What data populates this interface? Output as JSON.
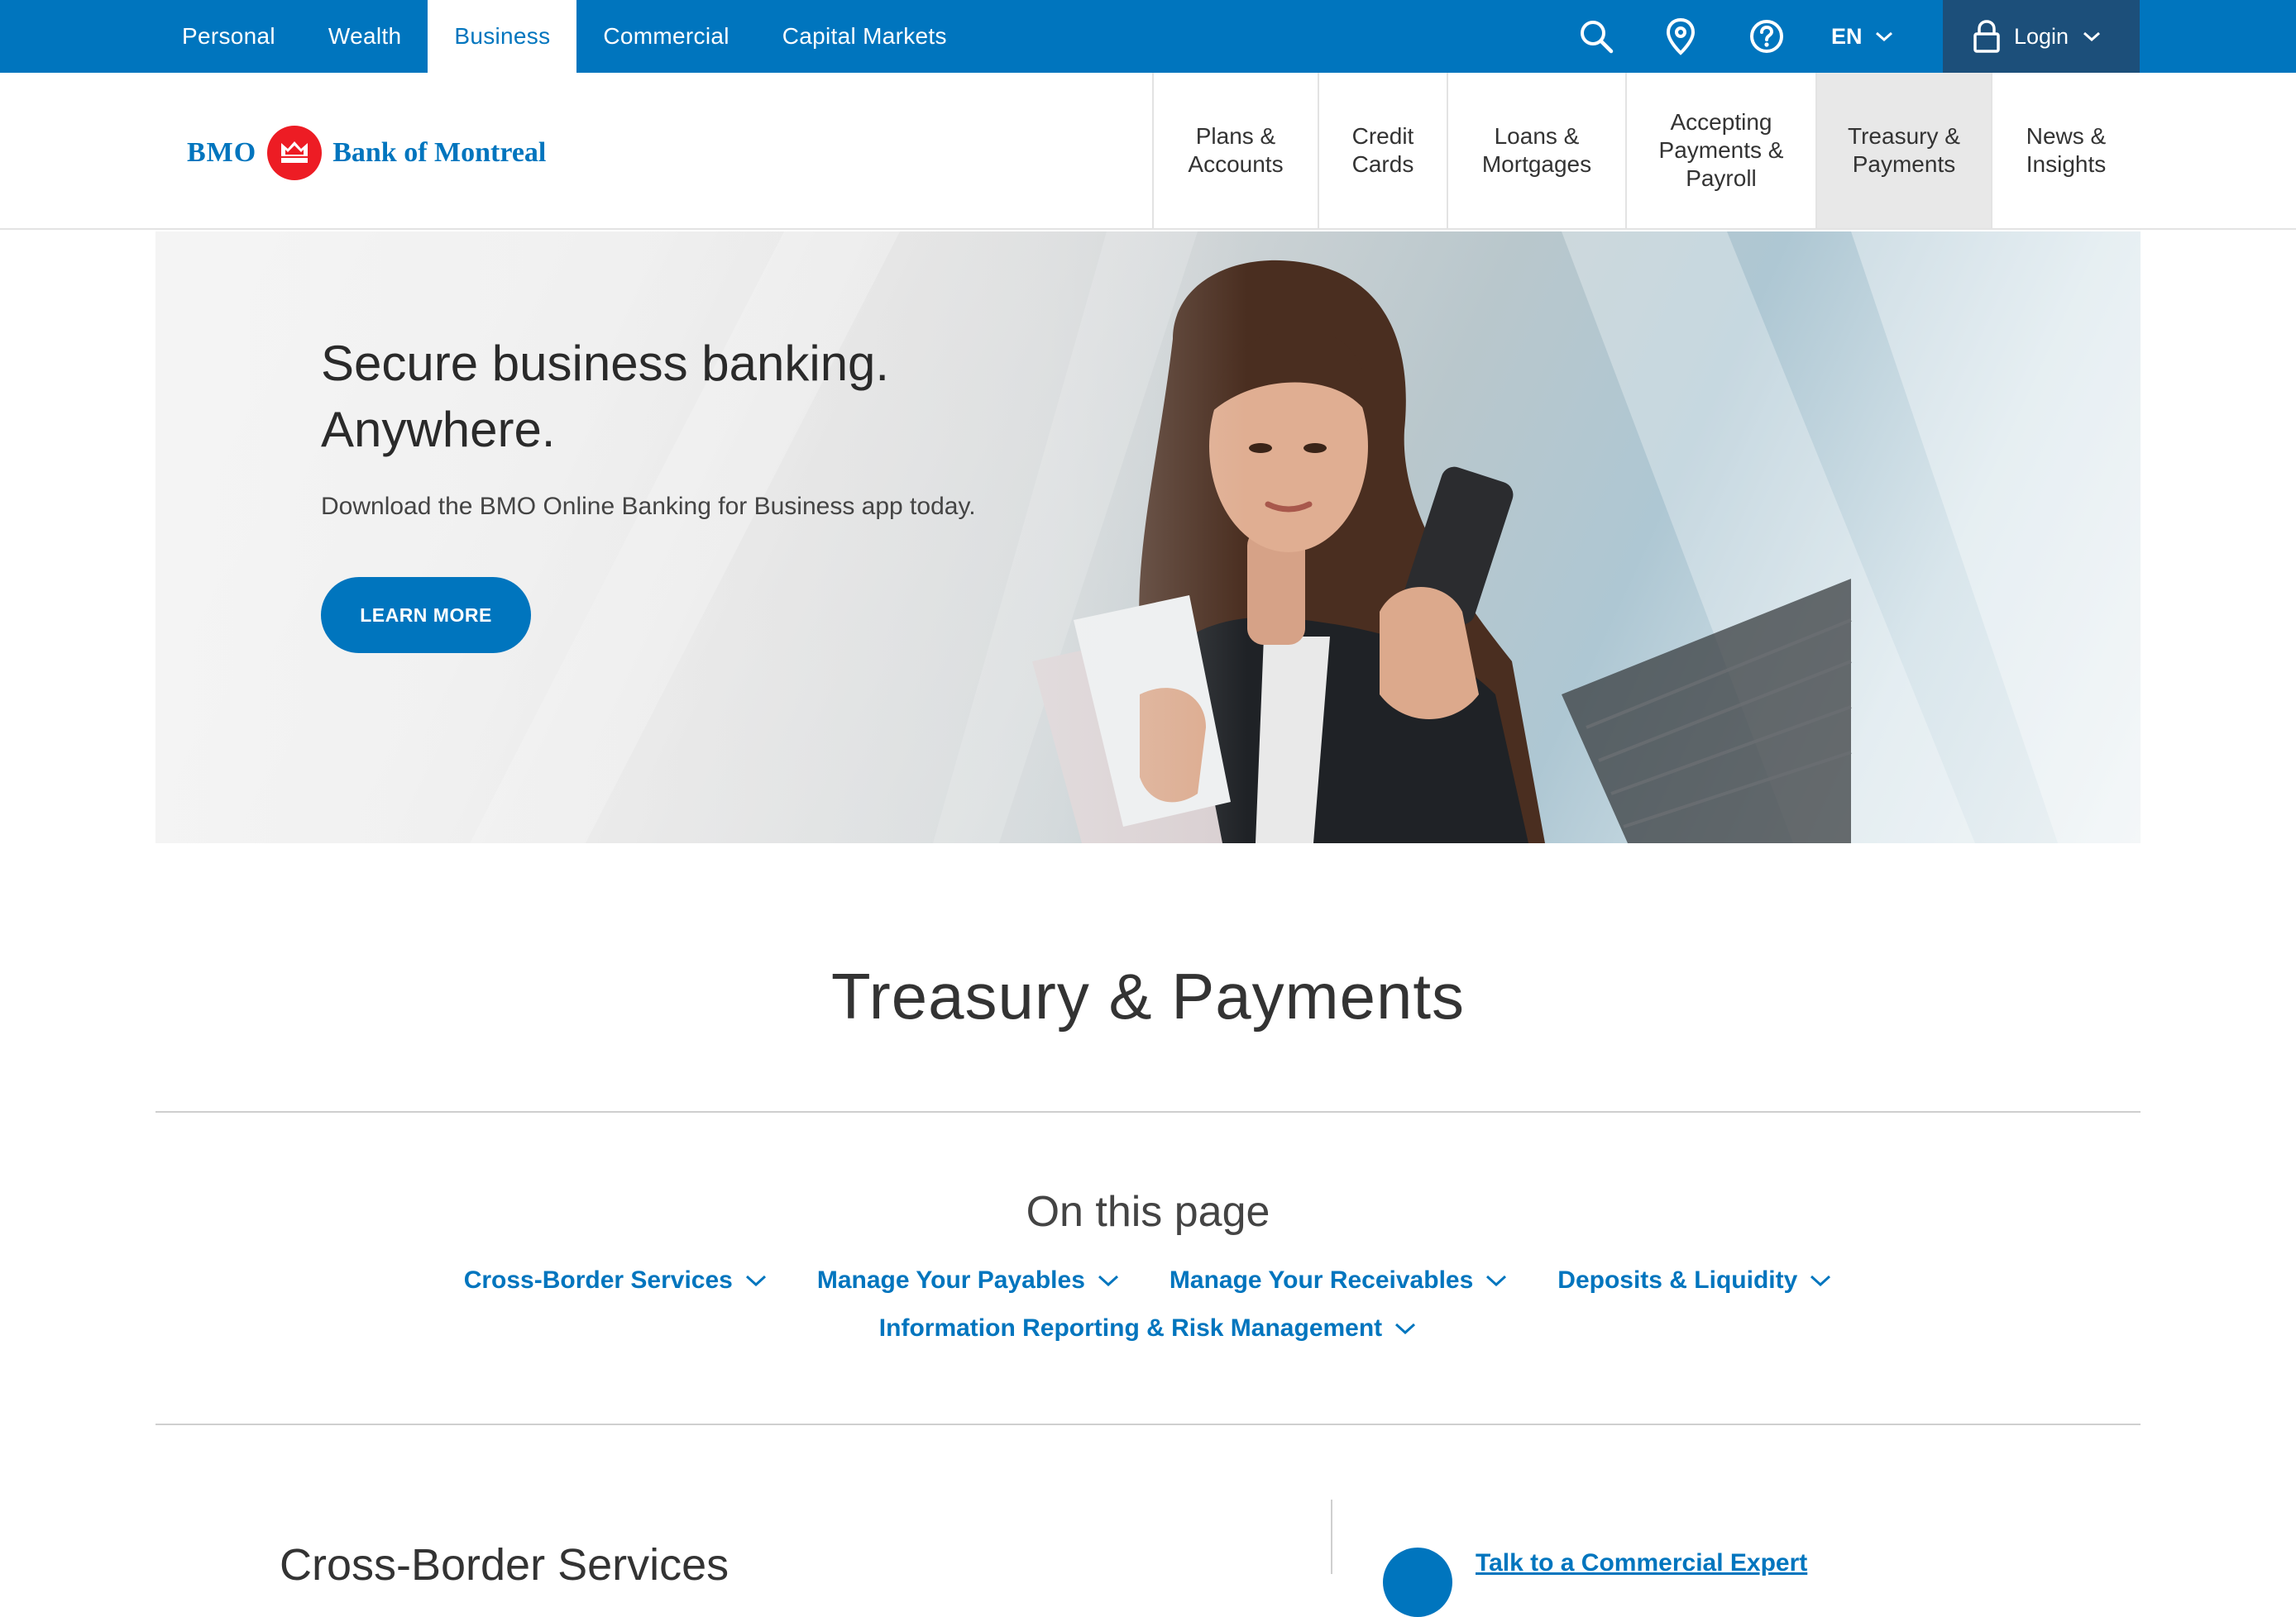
{
  "colors": {
    "brand_blue": "#0075be",
    "login_navy": "#1c4f7a",
    "logo_red": "#ed1c24"
  },
  "topbar": {
    "segments": [
      {
        "label": "Personal",
        "active": false
      },
      {
        "label": "Wealth",
        "active": false
      },
      {
        "label": "Business",
        "active": true
      },
      {
        "label": "Commercial",
        "active": false
      },
      {
        "label": "Capital Markets",
        "active": false
      }
    ],
    "icons": [
      "search-icon",
      "location-pin-icon",
      "help-icon"
    ],
    "language": "EN",
    "login_label": "Login"
  },
  "logo": {
    "bmo": "BMO",
    "name": "Bank of Montreal"
  },
  "mainnav": {
    "items": [
      {
        "label": "Plans &\nAccounts",
        "active": false
      },
      {
        "label": "Credit\nCards",
        "active": false
      },
      {
        "label": "Loans &\nMortgages",
        "active": false
      },
      {
        "label": "Accepting\nPayments &\nPayroll",
        "active": false
      },
      {
        "label": "Treasury &\nPayments",
        "active": true
      },
      {
        "label": "News &\nInsights",
        "active": false
      }
    ]
  },
  "hero": {
    "title_line1": "Secure business banking.",
    "title_line2": "Anywhere.",
    "subtitle": "Download the BMO Online Banking for Business app today.",
    "cta": "LEARN MORE"
  },
  "page_title": "Treasury & Payments",
  "on_this_page": {
    "heading": "On this page",
    "row1": [
      "Cross-Border Services",
      "Manage Your Payables",
      "Manage Your Receivables",
      "Deposits & Liquidity"
    ],
    "row2": [
      "Information Reporting & Risk Management"
    ]
  },
  "content": {
    "section_title": "Cross-Border Services",
    "expert_link": "Talk to a Commercial Expert"
  }
}
